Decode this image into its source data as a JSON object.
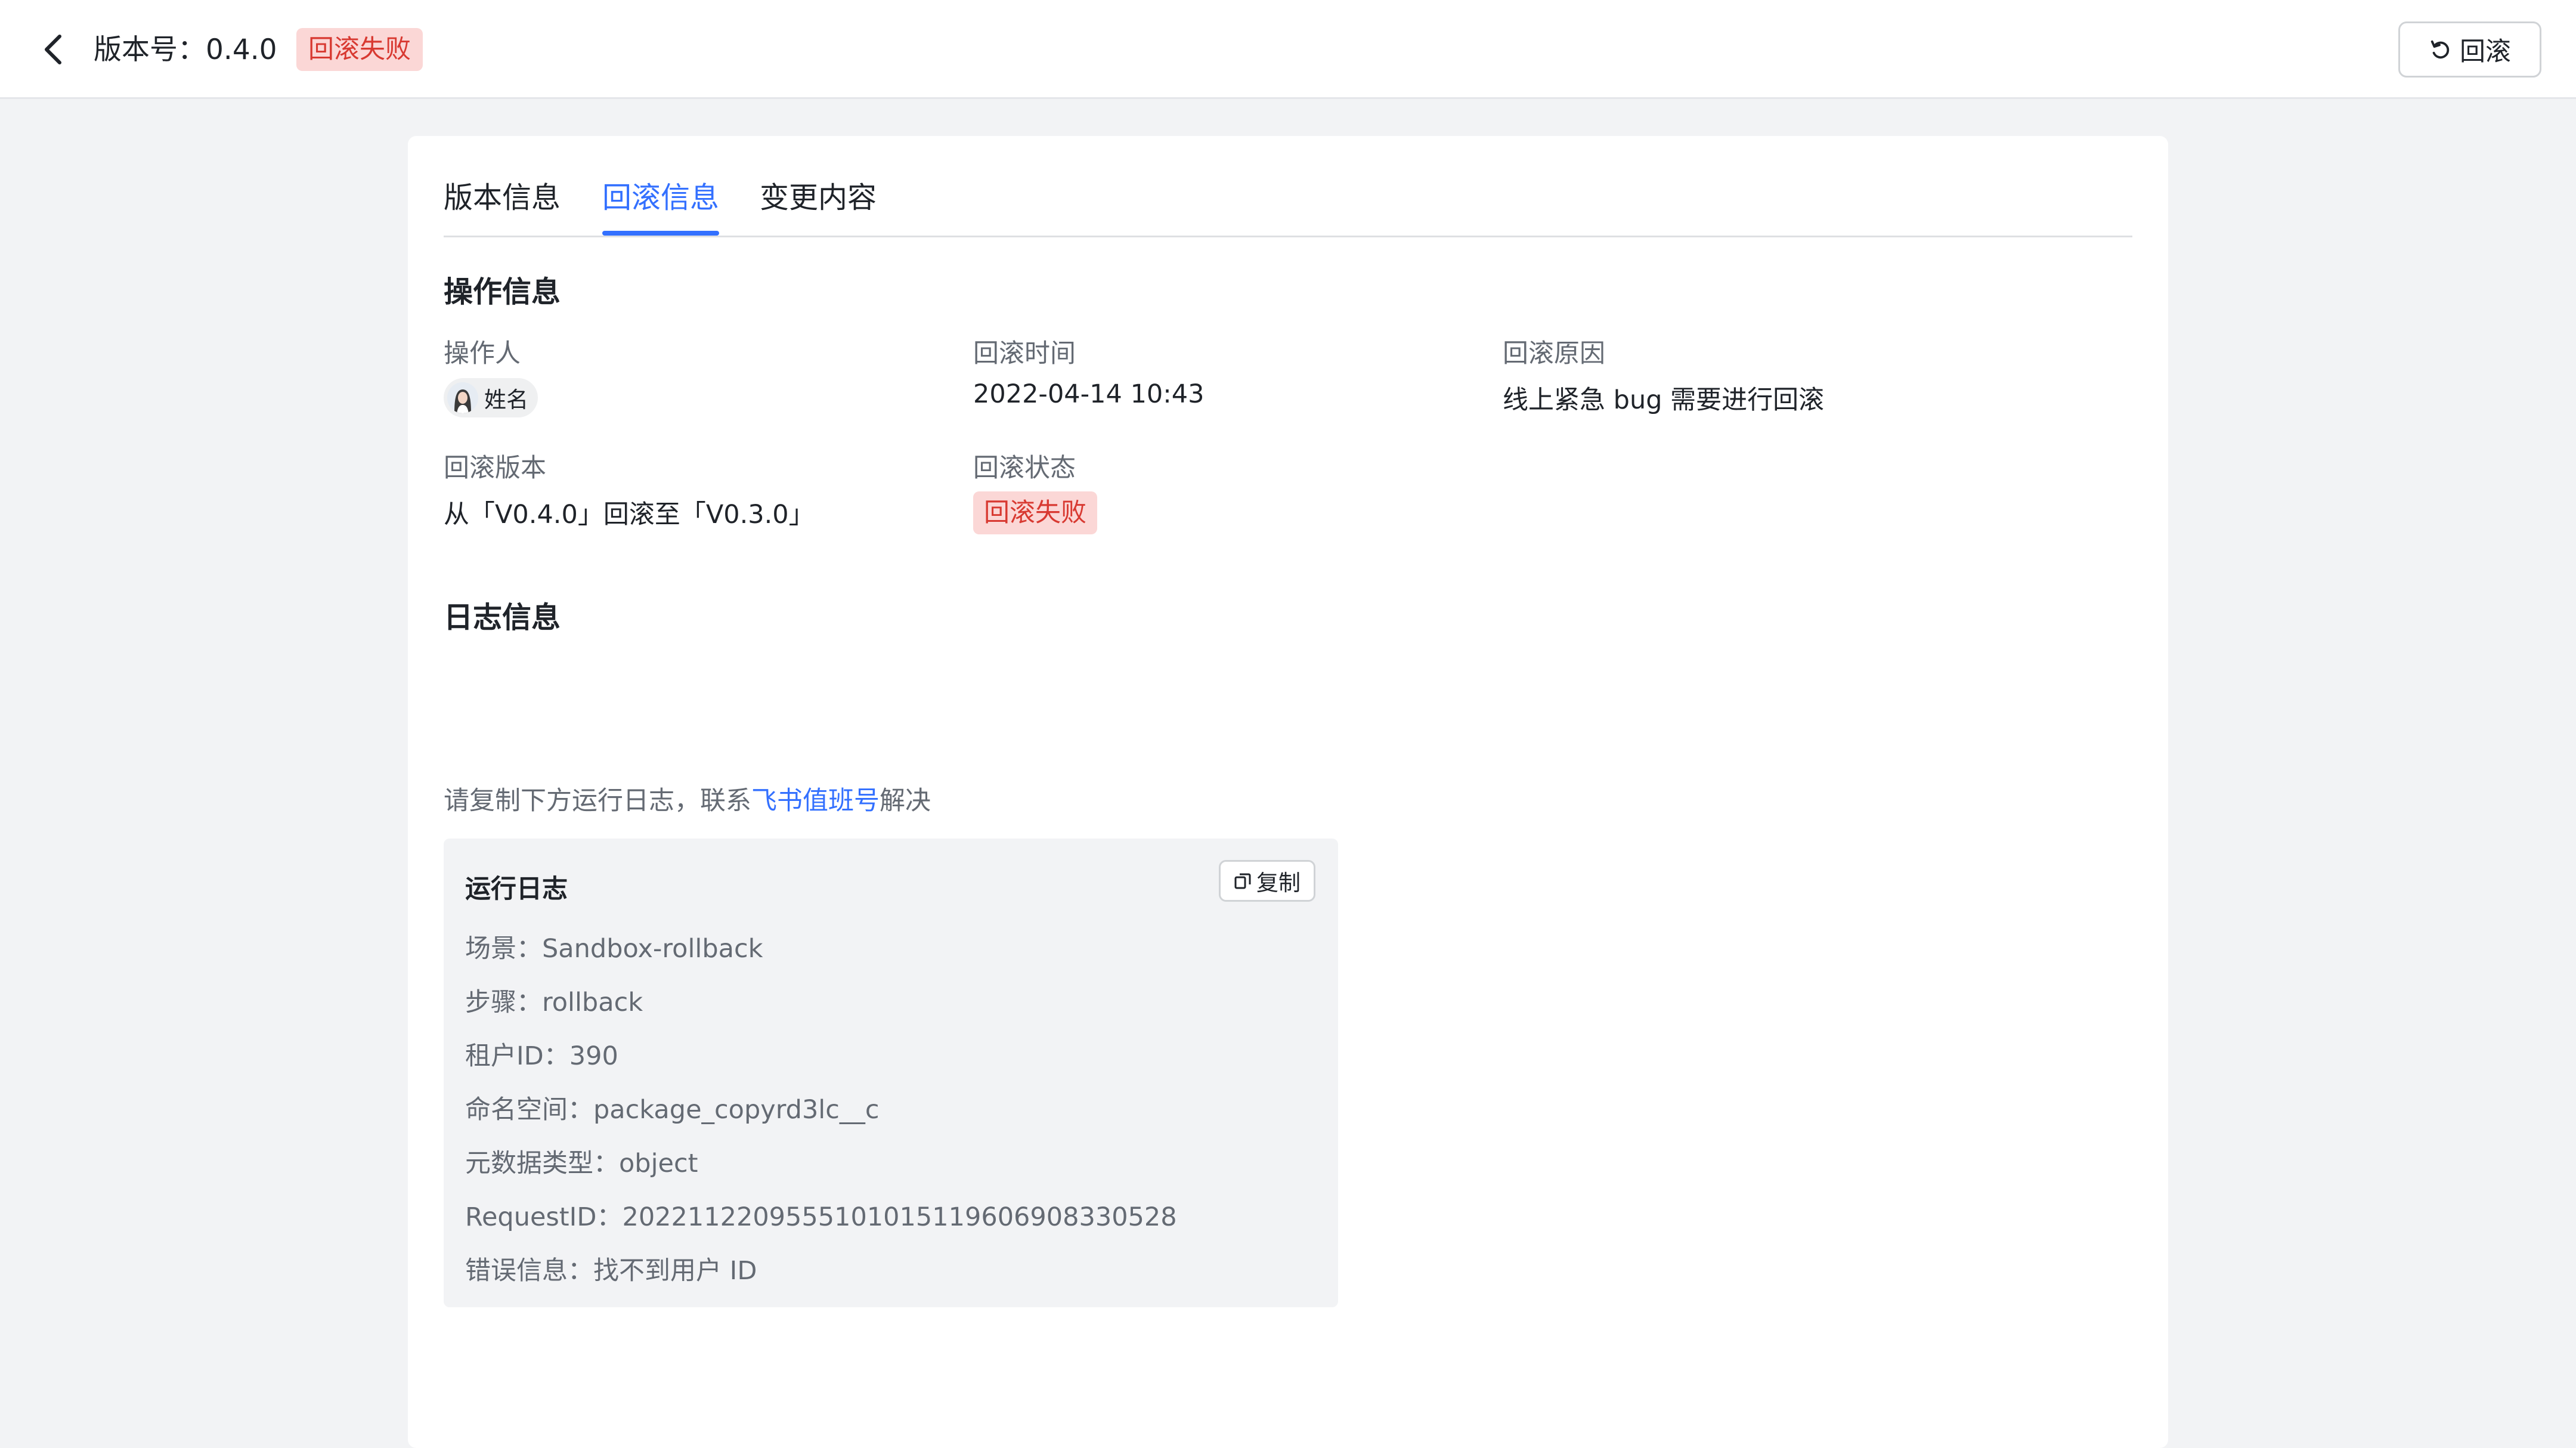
{
  "header": {
    "title": "版本号：0.4.0",
    "status_badge": "回滚失败",
    "rollback_button_label": "回滚"
  },
  "tabs": [
    {
      "label": "版本信息",
      "active": false
    },
    {
      "label": "回滚信息",
      "active": true
    },
    {
      "label": "变更内容",
      "active": false
    }
  ],
  "operation_info": {
    "section_title": "操作信息",
    "operator_label": "操作人",
    "operator_name": "姓名",
    "rollback_time_label": "回滚时间",
    "rollback_time": "2022-04-14 10:43",
    "rollback_reason_label": "回滚原因",
    "rollback_reason": "线上紧急 bug 需要进行回滚",
    "rollback_version_label": "回滚版本",
    "rollback_version": "从「V0.4.0」回滚至「V0.3.0」",
    "rollback_status_label": "回滚状态",
    "rollback_status": "回滚失败"
  },
  "log_info": {
    "section_title": "日志信息",
    "hint_prefix": "请复制下方运行日志，联系",
    "hint_link": "飞书值班号",
    "hint_suffix": "解决",
    "log_title": "运行日志",
    "copy_label": "复制",
    "lines": [
      " 场景：Sandbox-rollback",
      "步骤：rollback",
      "租户ID：390",
      "命名空间：package_copyrd3lc__c",
      "元数据类型：object",
      "RequestID：20221122095551010151196069083305​28",
      "错误信息：找不到用户 ID"
    ]
  },
  "colors": {
    "accent": "#3370ff",
    "danger_text": "#d83931",
    "danger_bg": "#fbd7d6",
    "page_bg": "#f2f3f5"
  }
}
